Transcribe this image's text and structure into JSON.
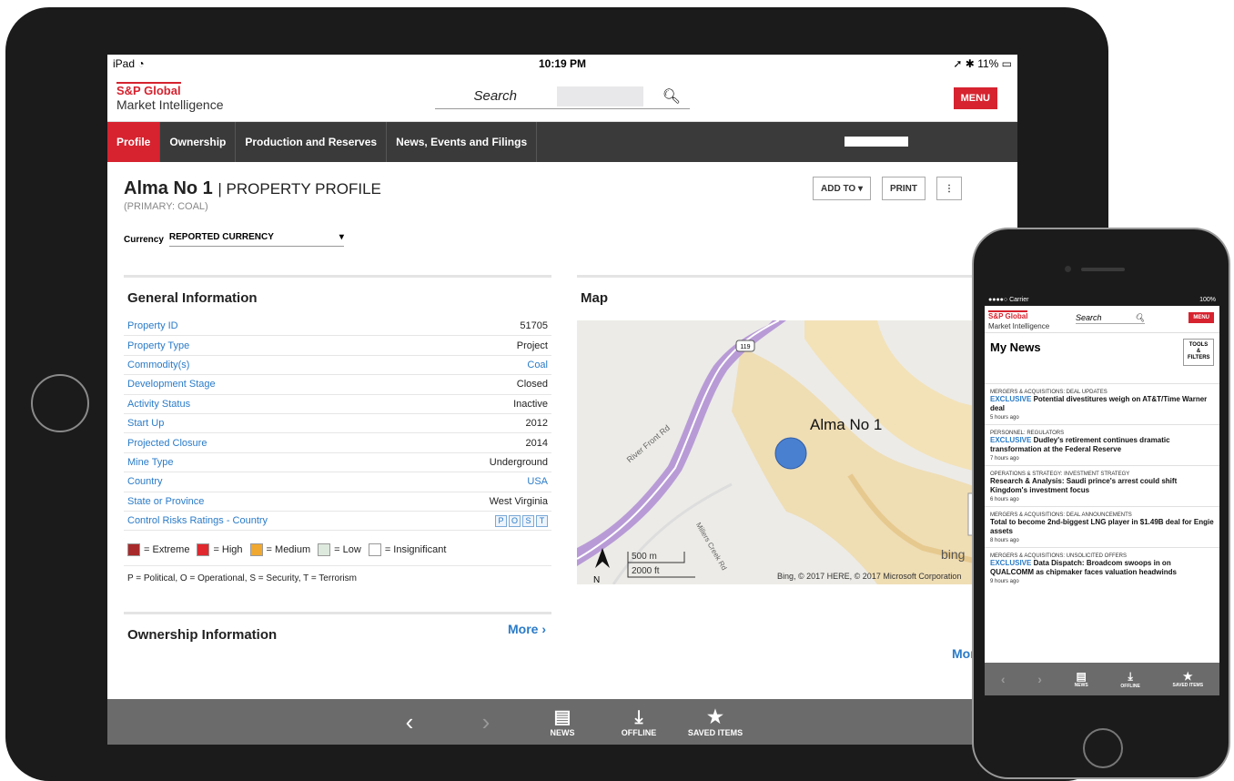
{
  "tablet": {
    "status": {
      "device": "iPad",
      "time": "10:19 PM",
      "battery": "11%"
    },
    "brand": {
      "line1": "S&P Global",
      "line2": "Market Intelligence"
    },
    "search_label": "Search",
    "menu": "MENU",
    "tabs": [
      "Profile",
      "Ownership",
      "Production and Reserves",
      "News, Events and Filings"
    ],
    "title": "Alma No 1",
    "title_suffix": "| PROPERTY PROFILE",
    "subtitle": "(PRIMARY: COAL)",
    "actions": {
      "add_to": "ADD TO",
      "print": "PRINT"
    },
    "currency": {
      "label": "Currency",
      "value": "REPORTED CURRENCY"
    },
    "general": {
      "title": "General Information",
      "rows": [
        {
          "k": "Property ID",
          "v": "51705"
        },
        {
          "k": "Property Type",
          "v": "Project"
        },
        {
          "k": "Commodity(s)",
          "v": "Coal"
        },
        {
          "k": "Development Stage",
          "v": "Closed"
        },
        {
          "k": "Activity Status",
          "v": "Inactive"
        },
        {
          "k": "Start Up",
          "v": "2012"
        },
        {
          "k": "Projected Closure",
          "v": "2014"
        },
        {
          "k": "Mine Type",
          "v": "Underground"
        },
        {
          "k": "Country",
          "v": "USA"
        },
        {
          "k": "State or Province",
          "v": "West Virginia"
        },
        {
          "k": "Control Risks Ratings - Country",
          "v": ""
        }
      ],
      "risk_boxes": [
        "P",
        "O",
        "S",
        "T"
      ],
      "legend": [
        {
          "label": "= Extreme",
          "color": "#a82a2a"
        },
        {
          "label": "= High",
          "color": "#e0282e"
        },
        {
          "label": "= Medium",
          "color": "#f0a830"
        },
        {
          "label": "= Low",
          "color": "#dde9dd"
        },
        {
          "label": "= Insignificant",
          "color": "#ffffff"
        }
      ],
      "note": "P = Political, O = Operational, S = Security, T = Terrorism"
    },
    "ownership": {
      "title": "Ownership Information",
      "more": "More ›"
    },
    "map": {
      "title": "Map",
      "label": "Alma No 1",
      "road": "River Front Rd",
      "road2": "Millers Creek Rd",
      "route": "119",
      "scale_m": "500 m",
      "scale_ft": "2000 ft",
      "north": "N",
      "credit": "Bing, © 2017 HERE, © 2017 Microsoft Corporation",
      "more": "More ›",
      "bing": "bing"
    },
    "bottom": {
      "news": "NEWS",
      "offline": "OFFLINE",
      "saved": "SAVED ITEMS"
    }
  },
  "phone": {
    "status": {
      "carrier": "●●●●○ Carrier",
      "battery": "100%"
    },
    "brand": {
      "line1": "S&P Global",
      "line2": "Market Intelligence"
    },
    "search_label": "Search",
    "menu": "MENU",
    "title": "My News",
    "tools": "TOOLS & FILTERS",
    "news": [
      {
        "cat": "MERGERS & ACQUISITIONS: DEAL UPDATES",
        "ex": "EXCLUSIVE",
        "title": "Potential divestitures weigh on AT&T/Time Warner deal",
        "time": "5 hours ago"
      },
      {
        "cat": "PERSONNEL: REGULATORS",
        "ex": "EXCLUSIVE",
        "title": "Dudley's retirement continues dramatic transformation at the Federal Reserve",
        "time": "7 hours ago"
      },
      {
        "cat": "OPERATIONS & STRATEGY: INVESTMENT STRATEGY",
        "ex": "",
        "title": "Research & Analysis: Saudi prince's arrest could shift Kingdom's investment focus",
        "time": "6 hours ago"
      },
      {
        "cat": "MERGERS & ACQUISITIONS: DEAL ANNOUNCEMENTS",
        "ex": "",
        "title": "Total to become 2nd-biggest LNG player in $1.49B deal for Engie assets",
        "time": "8 hours ago"
      },
      {
        "cat": "MERGERS & ACQUISITIONS: UNSOLICITED OFFERS",
        "ex": "EXCLUSIVE",
        "title": "Data Dispatch: Broadcom swoops in on QUALCOMM as chipmaker faces valuation headwinds",
        "time": "9 hours ago"
      }
    ],
    "bottom": {
      "news": "NEWS",
      "offline": "OFFLINE",
      "saved": "SAVED ITEMS"
    }
  }
}
